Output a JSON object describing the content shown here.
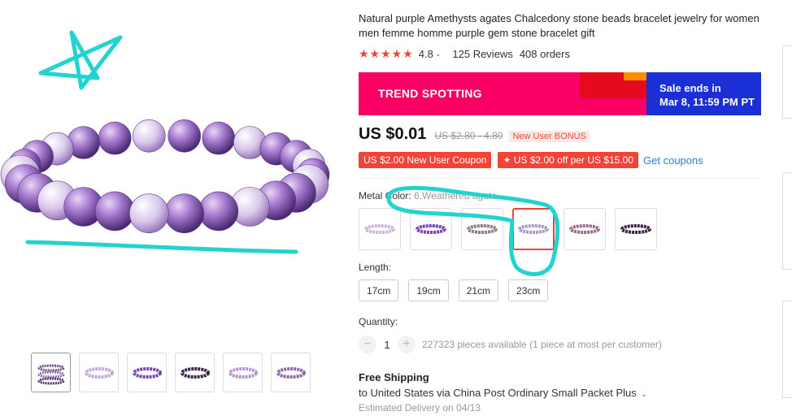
{
  "product": {
    "title": "Natural purple Amethysts agates Chalcedony stone beads bracelet jewelry for women men femme homme purple gem stone bracelet gift",
    "stars": "★★★★★",
    "rating": "4.8",
    "reviews": "125 Reviews",
    "orders": "408 orders"
  },
  "banner": {
    "left_text": "TREND SPOTTING",
    "sale_line1": "Sale ends in",
    "sale_line2": "Mar 8, 11:59 PM PT"
  },
  "price": {
    "current": "US $0.01",
    "original": "US $2.80 - 4.80",
    "new_user_badge": "New User BONUS"
  },
  "coupons": {
    "coupon1": "US $2.00 New User Coupon",
    "coupon2": "✦ US $2.00 off per US $15.00",
    "get_link": "Get coupons"
  },
  "metal_color": {
    "label": "Metal Color: ",
    "selected": "6.Weathered agate",
    "swatches": [
      "swatch-1",
      "swatch-2",
      "swatch-3",
      "swatch-4",
      "swatch-5",
      "swatch-6"
    ],
    "selected_index": 3
  },
  "length": {
    "label": "Length:",
    "options": [
      "17cm",
      "19cm",
      "21cm",
      "23cm"
    ]
  },
  "quantity": {
    "label": "Quantity:",
    "value": "1",
    "minus": "−",
    "plus": "+",
    "available": "227323 pieces available (1 piece at most per customer)"
  },
  "shipping": {
    "title": "Free Shipping",
    "detail": "to United States via China Post Ordinary Small Packet Plus",
    "estimated": "Estimated Delivery on 04/13"
  },
  "colors": {
    "accent_red": "#f44336",
    "banner_pink": "#fa0064",
    "banner_blue": "#1b2fd6",
    "link_blue": "#2e7cd6",
    "annotation_cyan": "#22d3d0"
  }
}
